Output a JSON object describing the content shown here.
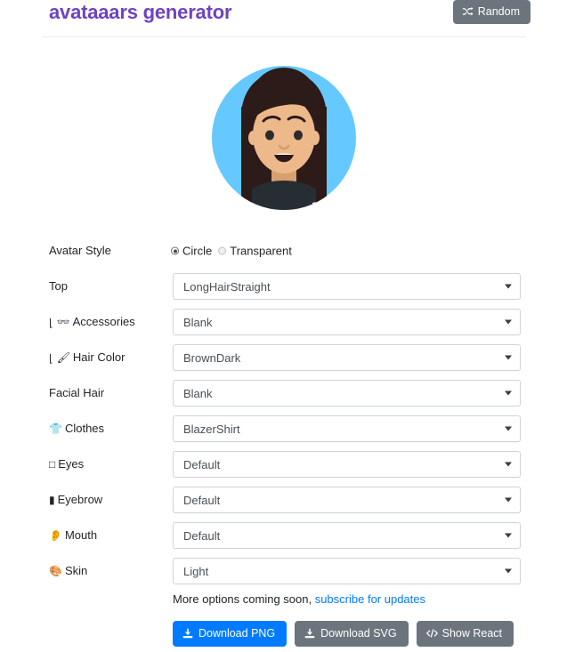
{
  "header": {
    "title": "avataaars generator",
    "random_button": {
      "label": "Random",
      "icon": "shuffle-icon",
      "color": "#6c757d"
    },
    "title_color": "#6f42c1"
  },
  "avatar": {
    "alt": "avatar-preview",
    "background_color": "#65c9ff",
    "hair_color": "#2c1b18",
    "skin_color": "#edb98a",
    "clothes_color": "#262e33",
    "style": "Circle"
  },
  "form": {
    "avatar_style": {
      "label": "Avatar Style",
      "options": [
        "Circle",
        "Transparent"
      ],
      "selected": "Circle"
    },
    "fields": [
      {
        "label": "Top",
        "icon": "",
        "sub": false,
        "value": "LongHairStraight"
      },
      {
        "label": "Accessories",
        "icon": "glasses-icon",
        "sub": true,
        "value": "Blank"
      },
      {
        "label": "Hair Color",
        "icon": "paintbrush-icon",
        "sub": true,
        "value": "BrownDark"
      },
      {
        "label": "Facial Hair",
        "icon": "",
        "sub": false,
        "value": "Blank"
      },
      {
        "label": "Clothes",
        "icon": "tshirt-icon",
        "sub": false,
        "value": "BlazerShirt"
      },
      {
        "label": "Eyes",
        "icon": "eyes-icon",
        "sub": false,
        "value": "Default"
      },
      {
        "label": "Eyebrow",
        "icon": "eyebrow-icon",
        "sub": false,
        "value": "Default"
      },
      {
        "label": "Mouth",
        "icon": "mouth-icon",
        "sub": false,
        "value": "Default"
      },
      {
        "label": "Skin",
        "icon": "palette-icon",
        "sub": false,
        "value": "Light"
      }
    ]
  },
  "footer": {
    "note_text": "More options coming soon, ",
    "note_link": "subscribe for updates",
    "buttons": [
      {
        "label": "Download PNG",
        "icon": "download-icon",
        "style": "primary",
        "color": "#007bff"
      },
      {
        "label": "Download SVG",
        "icon": "download-icon",
        "style": "secondary",
        "color": "#6c757d"
      },
      {
        "label": "Show React",
        "icon": "code-icon",
        "style": "secondary",
        "color": "#6c757d"
      }
    ]
  }
}
